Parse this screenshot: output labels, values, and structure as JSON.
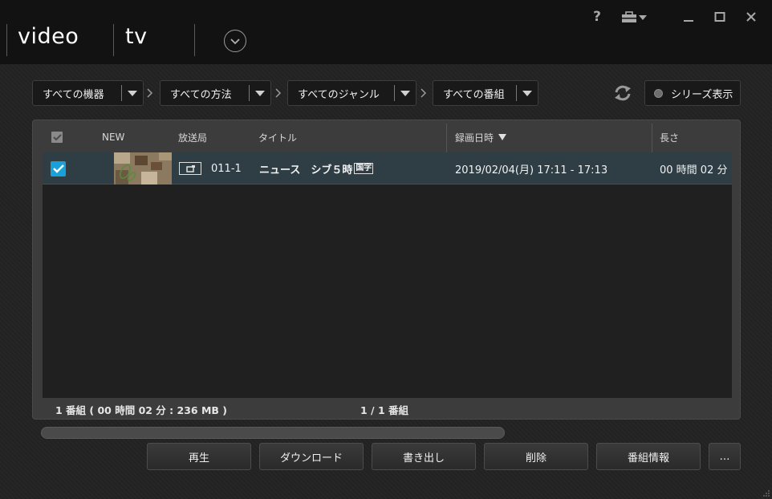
{
  "app": {
    "brand_video": "video",
    "brand_tv": "tv"
  },
  "window_controls": {
    "help": "?",
    "icons": [
      "help-icon",
      "toolbox-icon",
      "minimize-icon",
      "maximize-icon",
      "close-icon"
    ]
  },
  "filters": [
    {
      "label": "すべての機器"
    },
    {
      "label": "すべての方法"
    },
    {
      "label": "すべてのジャンル"
    },
    {
      "label": "すべての番組"
    }
  ],
  "series_toggle": {
    "label": "シリーズ表示"
  },
  "table": {
    "columns": {
      "new": "NEW",
      "station": "放送局",
      "title": "タイトル",
      "recorded": "録画日時",
      "length": "長さ"
    },
    "sort_column": "recorded",
    "rows": [
      {
        "checked": true,
        "channel": "011-1",
        "title": "ニュース　シブ５時",
        "title_suffix": "国字",
        "recorded": "2019/02/04(月) 17:11 - 17:13",
        "length": "00 時間 02 分"
      }
    ]
  },
  "status": {
    "summary": "1 番組 ( 00 時間 02 分 : 236 MB )",
    "page": "1 / 1 番組"
  },
  "actions": {
    "play": "再生",
    "download": "ダウンロード",
    "export": "書き出し",
    "delete": "削除",
    "info": "番組情報",
    "more": "…"
  },
  "colors": {
    "accent": "#1aa0d8",
    "selected_row": "#2e3e44"
  }
}
